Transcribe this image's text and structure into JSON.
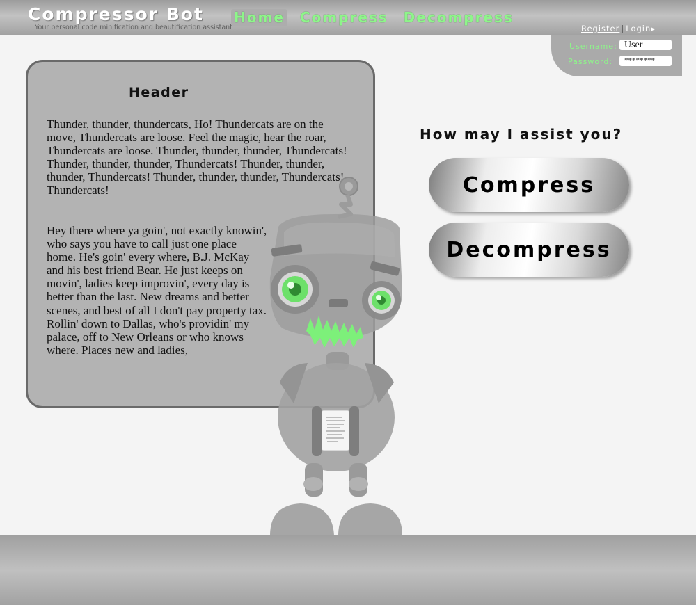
{
  "header": {
    "brand": "Compressor Bot",
    "tagline": "Your personal code minification and beautification assistant",
    "nav": [
      "Home",
      "Compress",
      "Decompress"
    ]
  },
  "auth": {
    "register": "Register",
    "separator": "|",
    "login": "Login▸",
    "username_label": "Username:",
    "username_value": "User",
    "password_label": "Password:",
    "password_value": "********"
  },
  "content": {
    "title": "Header",
    "paragraph1": "Thunder, thunder, thundercats, Ho! Thundercats are on the move, Thundercats are loose. Feel the magic, hear the roar, Thundercats are loose. Thunder, thunder, thunder, Thundercats! Thunder, thunder, thunder, Thundercats! Thunder, thunder, thunder, Thundercats! Thunder, thunder, thunder, Thundercats! Thundercats!",
    "paragraph2": "Hey there where ya goin', not exactly knowin', who says you have to call just one place home. He's goin' every where, B.J. McKay and his best friend Bear. He just keeps on movin', ladies keep improvin', every day is better than the last. New dreams and better scenes, and best of all I don't pay property tax. Rollin' down to Dallas, who's providin' my palace, off to New Orleans or who knows where. Places new and ladies,"
  },
  "assist": {
    "prompt": "How may I assist you?",
    "compress": "Compress",
    "decompress": "Decompress"
  },
  "colors": {
    "accent_green": "#8ef58a",
    "bar_gray": "#aaaaaa",
    "card_gray": "#b3b3b3"
  }
}
